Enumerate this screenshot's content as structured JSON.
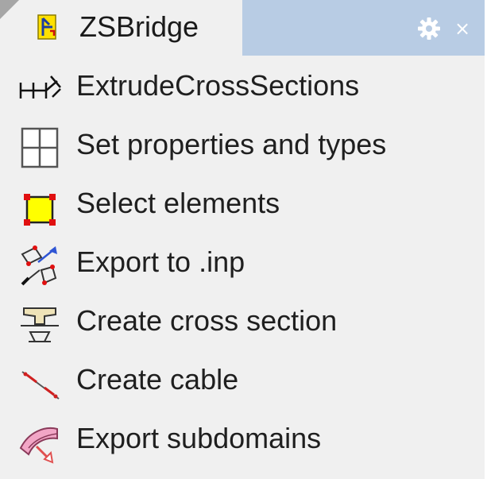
{
  "panel": {
    "tab": {
      "title": "ZSBridge",
      "icon": "zsbridge-plugin-icon",
      "settings_icon": "gear-icon",
      "close_label": "×"
    },
    "items": [
      {
        "label": "ExtrudeCrossSections",
        "icon": "extrude-cross-sections-icon"
      },
      {
        "label": "Set properties and types",
        "icon": "grid-table-icon"
      },
      {
        "label": "Select elements",
        "icon": "select-elements-icon"
      },
      {
        "label": "Export to .inp",
        "icon": "export-inp-icon"
      },
      {
        "label": "Create cross section",
        "icon": "cross-section-icon"
      },
      {
        "label": "Create cable",
        "icon": "cable-icon"
      },
      {
        "label": "Export subdomains",
        "icon": "export-subdomains-icon"
      }
    ]
  },
  "colors": {
    "panel_background": "#f0f0f0",
    "tab_bar_background": "#b8cce4",
    "tab_corner": "#a6a6a6",
    "select_fill": "#ffff00",
    "select_corners": "#e01010",
    "arrow_blue": "#2f55d4",
    "cable_red": "#d02020",
    "subdomain_pink": "#f2a6c6"
  }
}
